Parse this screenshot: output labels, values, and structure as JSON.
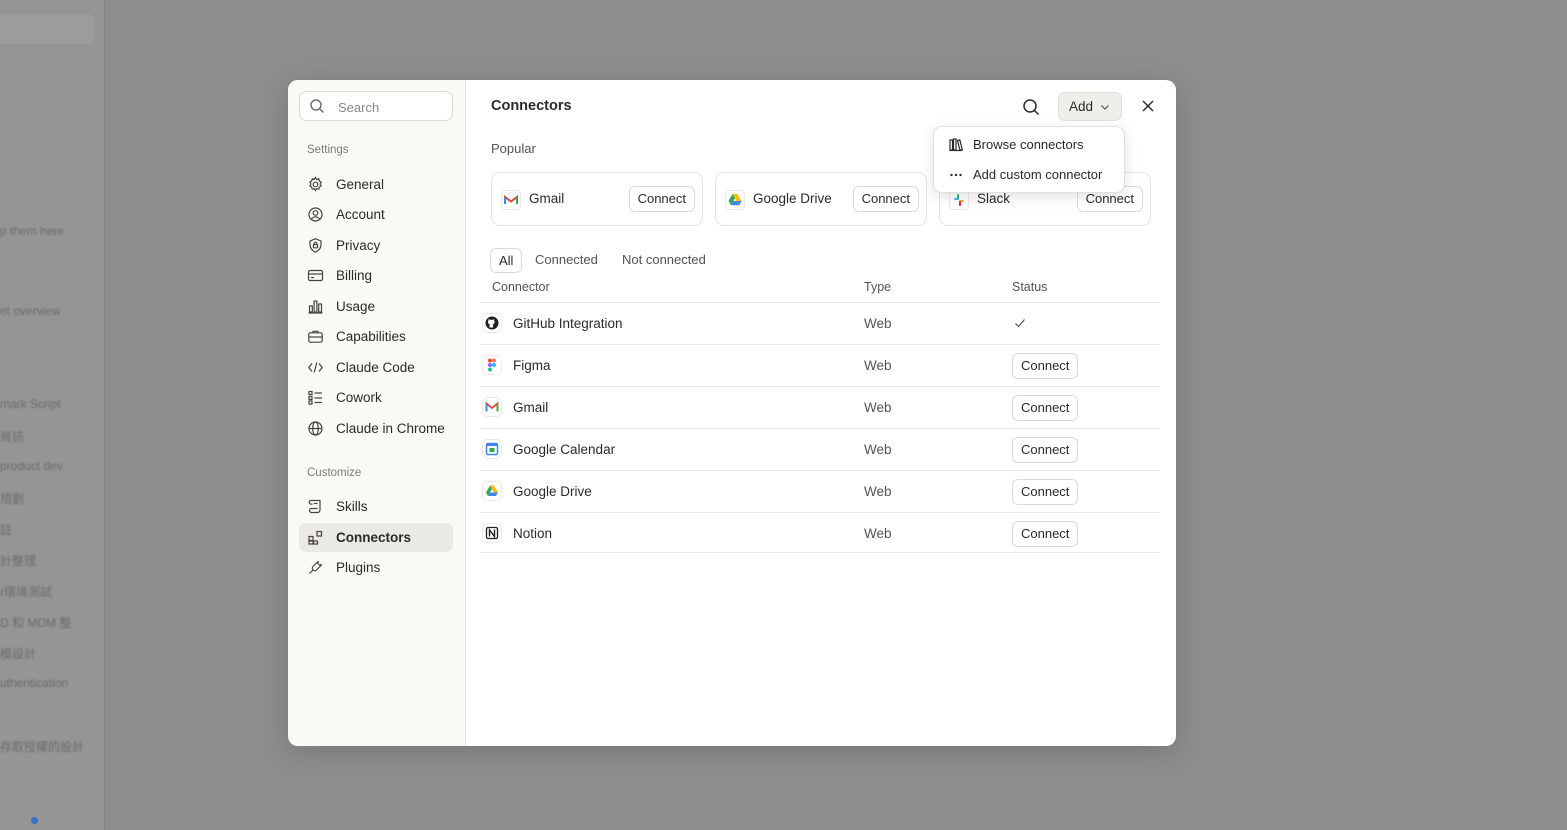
{
  "background": {
    "sidebar_fragments": [
      "p them here",
      "et overview",
      "mark Script",
      "資訊",
      "product dev",
      "規劃",
      "註",
      "計整理",
      "r環境測試",
      "D 和 MDM 整",
      "模設計",
      "uthentication",
      "存取授權的設計"
    ]
  },
  "sidebar": {
    "search_placeholder": "Search",
    "sections": [
      {
        "title": "Settings",
        "items": [
          {
            "label": "General",
            "icon": "gear-icon"
          },
          {
            "label": "Account",
            "icon": "user-circle-icon"
          },
          {
            "label": "Privacy",
            "icon": "shield-icon"
          },
          {
            "label": "Billing",
            "icon": "credit-card-icon"
          },
          {
            "label": "Usage",
            "icon": "bar-chart-icon"
          },
          {
            "label": "Capabilities",
            "icon": "briefcase-icon"
          },
          {
            "label": "Claude Code",
            "icon": "code-icon"
          },
          {
            "label": "Cowork",
            "icon": "list-icon"
          },
          {
            "label": "Claude in Chrome",
            "icon": "globe-icon"
          }
        ]
      },
      {
        "title": "Customize",
        "items": [
          {
            "label": "Skills",
            "icon": "scroll-icon"
          },
          {
            "label": "Connectors",
            "icon": "connectors-icon",
            "active": true
          },
          {
            "label": "Plugins",
            "icon": "plug-icon"
          }
        ]
      }
    ]
  },
  "main": {
    "title": "Connectors",
    "add_label": "Add",
    "popular_label": "Popular",
    "popular": [
      {
        "name": "Gmail",
        "button": "Connect"
      },
      {
        "name": "Google Drive",
        "button": "Connect"
      },
      {
        "name": "Slack",
        "button": "Connect"
      }
    ],
    "tabs": [
      "All",
      "Connected",
      "Not connected"
    ],
    "active_tab": "All",
    "columns": [
      "Connector",
      "Type",
      "Status"
    ],
    "rows": [
      {
        "name": "GitHub Integration",
        "type": "Web",
        "status": "connected",
        "icon": "github-icon"
      },
      {
        "name": "Figma",
        "type": "Web",
        "status": "Connect",
        "icon": "figma-icon"
      },
      {
        "name": "Gmail",
        "type": "Web",
        "status": "Connect",
        "icon": "gmail-icon"
      },
      {
        "name": "Google Calendar",
        "type": "Web",
        "status": "Connect",
        "icon": "google-calendar-icon"
      },
      {
        "name": "Google Drive",
        "type": "Web",
        "status": "Connect",
        "icon": "google-drive-icon"
      },
      {
        "name": "Notion",
        "type": "Web",
        "status": "Connect",
        "icon": "notion-icon"
      }
    ]
  },
  "dropdown": {
    "items": [
      {
        "label": "Browse connectors",
        "icon": "library-icon"
      },
      {
        "label": "Add custom connector",
        "icon": "more-horizontal-icon"
      }
    ]
  }
}
